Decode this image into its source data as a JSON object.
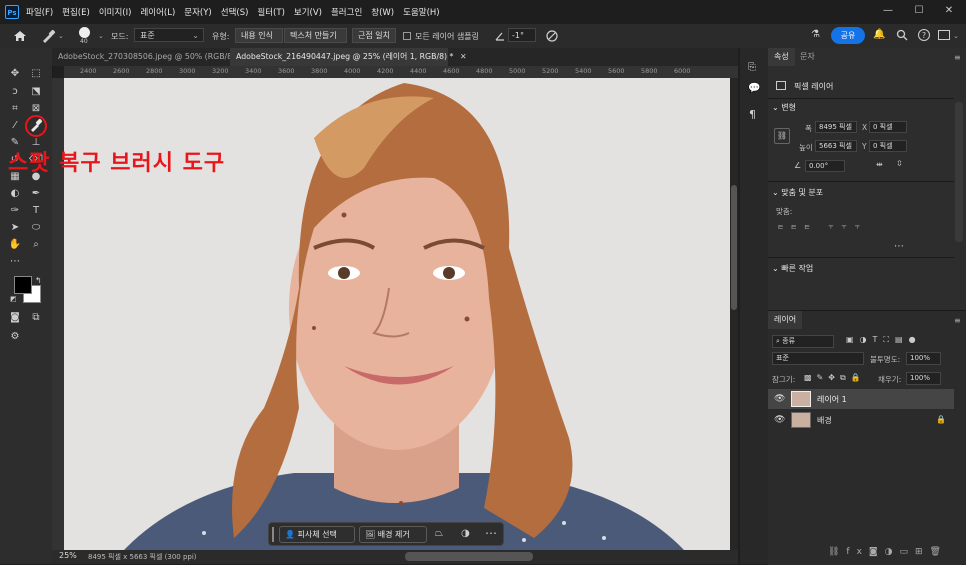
{
  "app": {
    "logo": "Ps"
  },
  "menu": [
    "파일(F)",
    "편집(E)",
    "이미지(I)",
    "레이어(L)",
    "문자(Y)",
    "선택(S)",
    "필터(T)",
    "보기(V)",
    "플러그인",
    "창(W)",
    "도움말(H)"
  ],
  "window_controls": [
    "minimize-icon",
    "maximize-icon",
    "close-icon"
  ],
  "options": {
    "brush_size": "40",
    "mode_label": "모드:",
    "mode_value": "표준",
    "type_label": "유형:",
    "type_options": [
      "내용 인식",
      "텍스처 만들기",
      "근접 일치"
    ],
    "sample_all_layers": "모든 레이어 샘플링",
    "angle": "-1°",
    "share_label": "공유"
  },
  "tabs": [
    {
      "label": "AdobeStock_270308506.jpeg @ 50% (RGB/8)",
      "active": false
    },
    {
      "label": "AdobeStock_216490447.jpeg @ 25% (레이어 1, RGB/8) *",
      "active": true
    }
  ],
  "ruler_ticks": [
    "2400",
    "2600",
    "2800",
    "3000",
    "3200",
    "3400",
    "3600",
    "3800",
    "4000",
    "4200",
    "4400",
    "4600",
    "4800",
    "5000",
    "5200",
    "5400",
    "5600",
    "5800",
    "6000"
  ],
  "annotation": "스팟 복구 브러시 도구",
  "context_bar": {
    "select_subject": "피사체 선택",
    "remove_bg": "배경 제거"
  },
  "status": {
    "zoom": "25%",
    "info": "8495 픽셀 x 5663 픽셀 (300 ppi)"
  },
  "properties": {
    "tab_properties": "속성",
    "tab_char": "문자",
    "layer_type": "픽셀 레이어",
    "transform_title": "변형",
    "w_label": "폭",
    "w_value": "8495 픽셀",
    "x_label": "X",
    "x_value": "0 픽셀",
    "h_label": "높이",
    "h_value": "5663 픽셀",
    "y_label": "Y",
    "y_value": "0 픽셀",
    "angle_value": "0.00°",
    "align_title": "맞춤 및 분포",
    "align_label": "맞춤:",
    "quick_actions": "빠른 작업"
  },
  "layers_panel": {
    "title": "레이어",
    "filter": "종류",
    "blend_mode": "표준",
    "opacity_label": "불투명도:",
    "opacity_value": "100%",
    "lock_label": "잠그기:",
    "fill_label": "채우기:",
    "fill_value": "100%",
    "layers": [
      {
        "name": "레이어 1",
        "selected": true,
        "locked": false
      },
      {
        "name": "배경",
        "selected": false,
        "locked": true
      }
    ]
  },
  "colors": {
    "accent": "#1473e6",
    "annotation": "#e8161b",
    "canvas_bg": "#e3e2e1"
  }
}
